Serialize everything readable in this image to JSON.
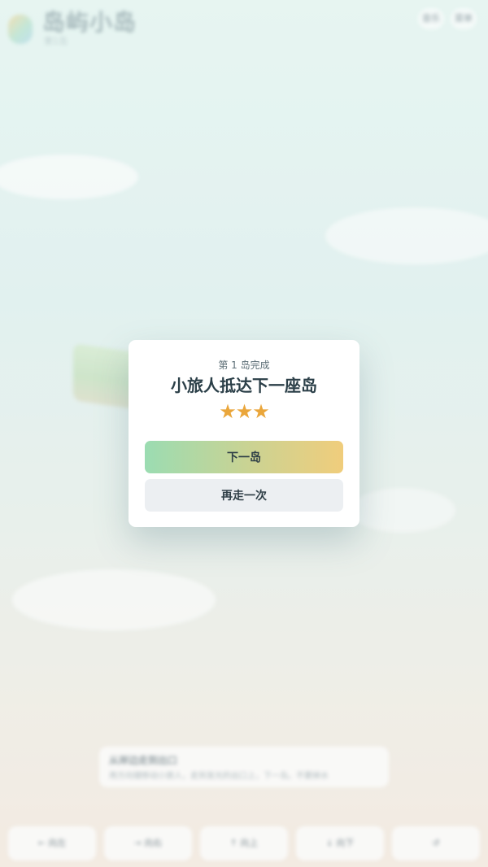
{
  "header": {
    "title": "岛屿小岛",
    "subtitle": "第1岛",
    "buttons": [
      "音乐",
      "菜单"
    ]
  },
  "hint": {
    "title": "从岸边走到出口",
    "text": "用方向键移动小旅人，走到发光的出口上，下一岛。不要掉水"
  },
  "controls": [
    "← 向左",
    "→ 向右",
    "↑ 向上",
    "↓ 向下",
    "↺"
  ],
  "modal": {
    "subtitle": "第 1 岛完成",
    "title": "小旅人抵达下一座岛",
    "stars": [
      "★",
      "★",
      "★"
    ],
    "star_count": 3,
    "next_label": "下一岛",
    "retry_label": "再走一次"
  },
  "colors": {
    "star": "#eaa63b",
    "next_gradient_start": "#9bdcb2",
    "next_gradient_end": "#f0cd7c",
    "retry_bg": "#eceff2",
    "title": "#2b3f48"
  }
}
